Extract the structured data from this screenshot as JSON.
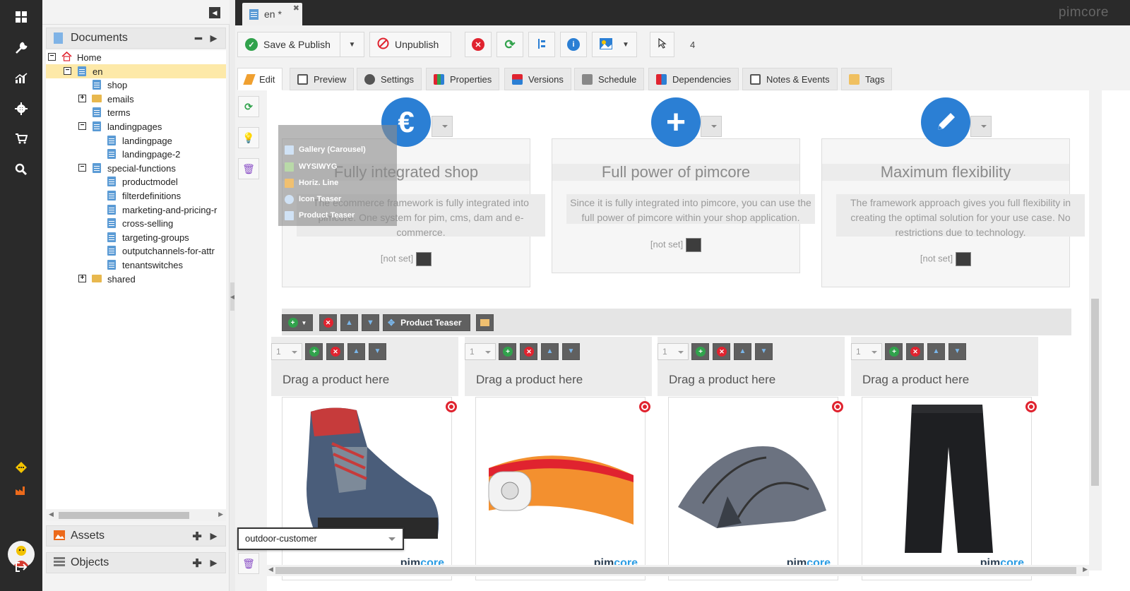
{
  "sidebar_nav": {
    "icons": [
      "dashboard-icon",
      "wrench-icon",
      "analytics-icon",
      "gear-icon",
      "cart-icon",
      "search-icon",
      "notification-icon",
      "factory-icon",
      "user-avatar",
      "logout-icon"
    ]
  },
  "tree_panel": {
    "documents_title": "Documents",
    "assets_title": "Assets",
    "objects_title": "Objects",
    "items": [
      {
        "label": "Home",
        "level": 0,
        "type": "home",
        "expanded": true
      },
      {
        "label": "en",
        "level": 1,
        "type": "doc",
        "expanded": true,
        "selected": true
      },
      {
        "label": "shop",
        "level": 2,
        "type": "doc"
      },
      {
        "label": "emails",
        "level": 2,
        "type": "folder",
        "expanded": false
      },
      {
        "label": "terms",
        "level": 2,
        "type": "doc"
      },
      {
        "label": "landingpages",
        "level": 2,
        "type": "doc",
        "expanded": true
      },
      {
        "label": "landingpage",
        "level": 3,
        "type": "doc"
      },
      {
        "label": "landingpage-2",
        "level": 3,
        "type": "doc"
      },
      {
        "label": "special-functions",
        "level": 2,
        "type": "doc",
        "expanded": true
      },
      {
        "label": "productmodel",
        "level": 3,
        "type": "doc"
      },
      {
        "label": "filterdefinitions",
        "level": 3,
        "type": "doc"
      },
      {
        "label": "marketing-and-pricing-r",
        "level": 3,
        "type": "doc"
      },
      {
        "label": "cross-selling",
        "level": 3,
        "type": "doc"
      },
      {
        "label": "targeting-groups",
        "level": 3,
        "type": "doc"
      },
      {
        "label": "outputchannels-for-attr",
        "level": 3,
        "type": "doc"
      },
      {
        "label": "tenantswitches",
        "level": 3,
        "type": "doc"
      },
      {
        "label": "shared",
        "level": 2,
        "type": "folder",
        "expanded": false
      }
    ]
  },
  "topbar": {
    "tab_label": "en *",
    "brand": "pimcore"
  },
  "toolbar": {
    "save_publish": "Save & Publish",
    "unpublish": "Unpublish",
    "count": "4"
  },
  "edit_tabs": [
    "Edit",
    "Preview",
    "Settings",
    "Properties",
    "Versions",
    "Schedule",
    "Dependencies",
    "Notes & Events",
    "Tags"
  ],
  "features": [
    {
      "title": "Fully integrated shop",
      "text": "The ecommerce framework is fully integrated into pimcore. One system for pim, cms, dam and e-commerce.",
      "image": "[not set]",
      "badge": "€"
    },
    {
      "title": "Full power of pimcore",
      "text": "Since it is fully integrated into pimcore, you can use the full power of pimcore within your shop application.",
      "image": "[not set]",
      "badge": "+"
    },
    {
      "title": "Maximum flexibility",
      "text": "The framework approach gives you full flexibility in creating the optimal solution for your use case. No restrictions due to technology.",
      "image": "[not set]",
      "badge": "pencil"
    }
  ],
  "areablock_menu": [
    "Gallery (Carousel)",
    "WYSIWYG",
    "Horiz. Line",
    "Icon Teaser",
    "Product Teaser"
  ],
  "product_teaser": {
    "label": "Product Teaser",
    "slots": [
      {
        "number": "1",
        "drag_text": "Drag a product here",
        "product": "hiking-boot"
      },
      {
        "number": "1",
        "drag_text": "Drag a product here",
        "product": "headlamp"
      },
      {
        "number": "1",
        "drag_text": "Drag a product here",
        "product": "tent"
      },
      {
        "number": "1",
        "drag_text": "Drag a product here",
        "product": "trousers"
      }
    ],
    "logo_a": "pim",
    "logo_b": "core"
  },
  "target_group": "outdoor-customer",
  "colors": {
    "accent": "#2b7fd4",
    "dark": "#2a2a2a",
    "danger": "#e0232f",
    "success": "#31a24c"
  }
}
